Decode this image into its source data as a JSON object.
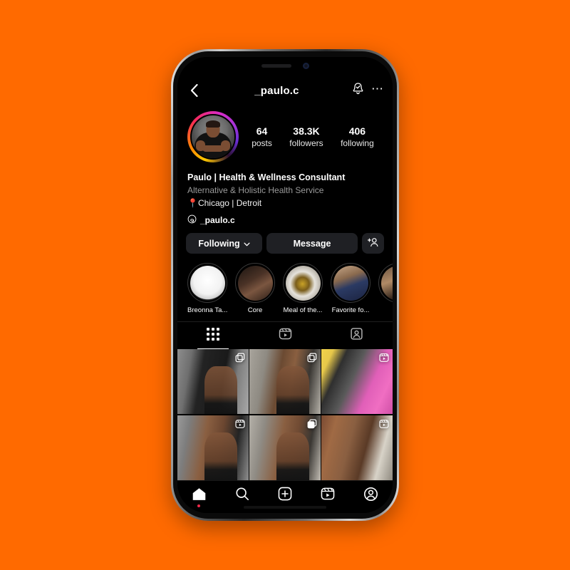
{
  "theme": {
    "page_background": "#FF6A00",
    "app_background": "#000000",
    "button_background": "#1f2024",
    "accent_notification": "#f02849",
    "muted_text": "#9a9a9a"
  },
  "header": {
    "back_icon": "chevron-left-icon",
    "title": "_paulo.c",
    "notifications_icon": "bell-check-icon",
    "more_icon": "ellipsis-icon"
  },
  "profile": {
    "avatar_name": "profile-avatar",
    "stats": [
      {
        "num": "64",
        "label": "posts"
      },
      {
        "num": "38.3K",
        "label": "followers"
      },
      {
        "num": "406",
        "label": "following"
      }
    ],
    "display_name": "Paulo | Health & Wellness Consultant",
    "category": "Alternative & Holistic Health Service",
    "location": "📍Chicago | Detroit",
    "threads_icon": "threads-icon",
    "threads_handle": "_paulo.c"
  },
  "actions": {
    "following_label": "Following",
    "following_caret": "chevron-down-icon",
    "message_label": "Message",
    "add_user_icon": "add-user-icon"
  },
  "highlights": [
    {
      "label": "Breonna Ta...",
      "art": "img-breonna"
    },
    {
      "label": "Core",
      "art": "img-core"
    },
    {
      "label": "Meal of the...",
      "art": "img-meal"
    },
    {
      "label": "Favorite fo...",
      "art": "img-fav"
    },
    {
      "label": "",
      "art": "img-five"
    }
  ],
  "tabs": [
    {
      "name": "grid",
      "icon": "grid-icon",
      "active": true
    },
    {
      "name": "reels",
      "icon": "reels-icon",
      "active": false
    },
    {
      "name": "tagged",
      "icon": "tagged-person-icon",
      "active": false
    }
  ],
  "posts": [
    {
      "art": "p1",
      "overlay": "carousel-icon"
    },
    {
      "art": "p2",
      "overlay": "carousel-icon"
    },
    {
      "art": "p3",
      "overlay": "reel-icon"
    },
    {
      "art": "p4",
      "overlay": "reel-icon"
    },
    {
      "art": "p5",
      "overlay": "carousel-icon"
    },
    {
      "art": "p6",
      "overlay": "reel-icon"
    }
  ],
  "bottom_nav": [
    {
      "name": "home",
      "icon": "home-icon",
      "active": true,
      "dot": true
    },
    {
      "name": "search",
      "icon": "search-icon",
      "active": false,
      "dot": false
    },
    {
      "name": "create",
      "icon": "plus-square-icon",
      "active": false,
      "dot": false
    },
    {
      "name": "reels",
      "icon": "reels-icon",
      "active": false,
      "dot": false
    },
    {
      "name": "profile",
      "icon": "profile-circle-icon",
      "active": false,
      "dot": false
    }
  ]
}
